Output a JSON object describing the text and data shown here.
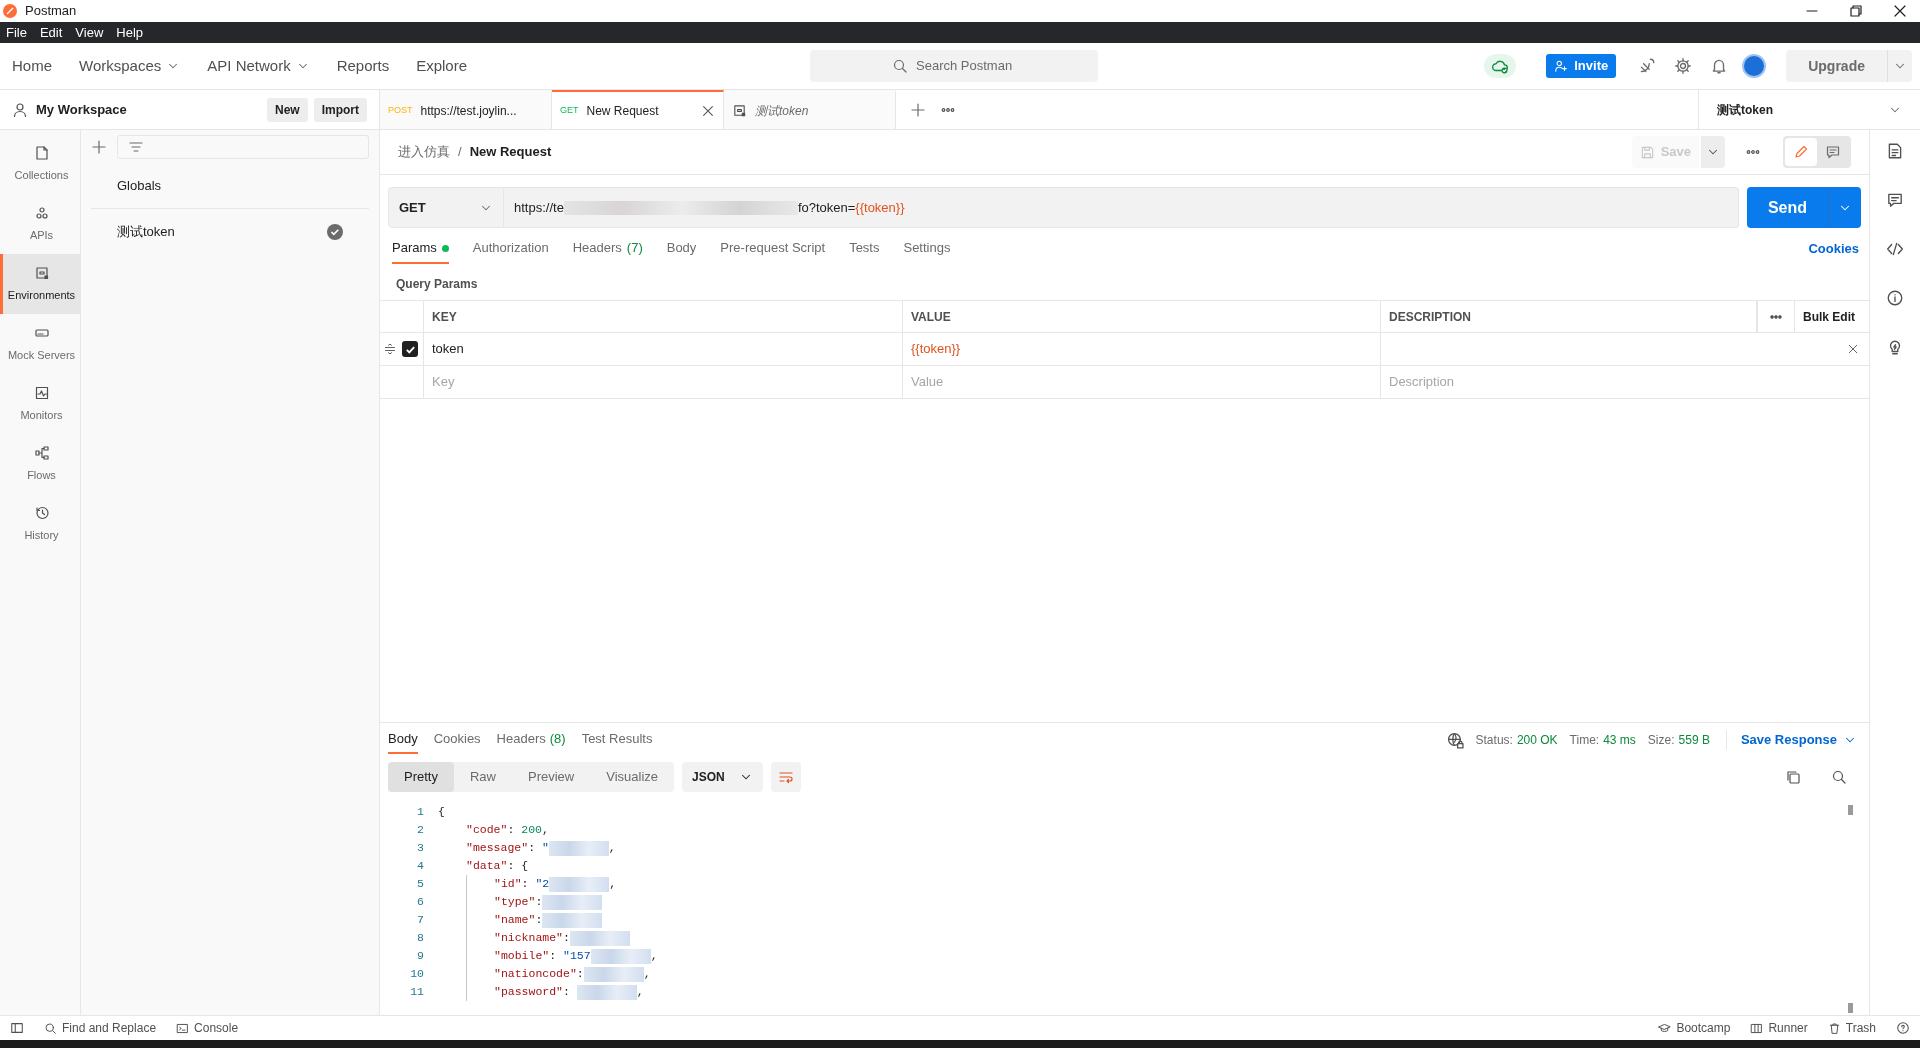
{
  "window": {
    "title": "Postman"
  },
  "menu": [
    "File",
    "Edit",
    "View",
    "Help"
  ],
  "header": {
    "nav": [
      {
        "label": "Home",
        "dropdown": false
      },
      {
        "label": "Workspaces",
        "dropdown": true
      },
      {
        "label": "API Network",
        "dropdown": true
      },
      {
        "label": "Reports",
        "dropdown": false
      },
      {
        "label": "Explore",
        "dropdown": false
      }
    ],
    "search": {
      "placeholder": "Search Postman"
    },
    "invite": "Invite",
    "upgrade": "Upgrade"
  },
  "workspace": {
    "name": "My Workspace",
    "buttons": [
      "New",
      "Import"
    ]
  },
  "rail": [
    {
      "label": "Collections",
      "selected": false
    },
    {
      "label": "APIs",
      "selected": false
    },
    {
      "label": "Environments",
      "selected": true
    },
    {
      "label": "Mock Servers",
      "selected": false
    },
    {
      "label": "Monitors",
      "selected": false
    },
    {
      "label": "Flows",
      "selected": false
    },
    {
      "label": "History",
      "selected": false
    }
  ],
  "environments": [
    {
      "label": "Globals",
      "active": false
    },
    {
      "label": "测试token",
      "active": true
    }
  ],
  "tabs": [
    {
      "kind": "request",
      "method": "POST",
      "label": "https://test.joylin...",
      "selected": false
    },
    {
      "kind": "request",
      "method": "GET",
      "label": "New Request",
      "selected": true
    },
    {
      "kind": "environment",
      "label": "测试token",
      "selected": false
    }
  ],
  "environment_selector": "测试token",
  "breadcrumb": [
    "进入仿真",
    "New Request"
  ],
  "breadcrumb_separator": "/",
  "save": {
    "label": "Save",
    "disabled": true
  },
  "request": {
    "method": "GET",
    "url": [
      {
        "kind": "text",
        "text": "https://te"
      },
      {
        "kind": "redacted"
      },
      {
        "kind": "text",
        "text": "fo?token="
      },
      {
        "kind": "variable",
        "text": "{{token}}"
      }
    ],
    "send": "Send"
  },
  "request_tabs": [
    {
      "label": "Params",
      "dot": true,
      "selected": true
    },
    {
      "label": "Authorization",
      "dot": false,
      "selected": false
    },
    {
      "label": "Headers",
      "count": "(7)",
      "dot": false,
      "selected": false
    },
    {
      "label": "Body",
      "dot": false,
      "selected": false
    },
    {
      "label": "Pre-request Script",
      "dot": false,
      "selected": false
    },
    {
      "label": "Tests",
      "dot": false,
      "selected": false
    },
    {
      "label": "Settings",
      "dot": false,
      "selected": false
    }
  ],
  "cookies_link": "Cookies",
  "query_params": {
    "title": "Query Params",
    "columns": [
      "KEY",
      "VALUE",
      "DESCRIPTION"
    ],
    "bulk_edit": "Bulk Edit",
    "rows": [
      {
        "key": "token",
        "value": "{{token}}",
        "checked": true
      }
    ],
    "new_row": [
      {
        "placeholder": "Key"
      },
      {
        "placeholder": "Value"
      },
      {
        "placeholder": "Description"
      }
    ]
  },
  "response": {
    "tabs": [
      {
        "label": "Body",
        "selected": true
      },
      {
        "label": "Cookies",
        "selected": false
      },
      {
        "label": "Headers",
        "count": "(8)",
        "selected": false
      },
      {
        "label": "Test Results",
        "selected": false
      }
    ],
    "stats": [
      {
        "label": "Status:",
        "value": "200 OK"
      },
      {
        "label": "Time:",
        "value": "43 ms"
      },
      {
        "label": "Size:",
        "value": "559 B"
      }
    ],
    "save_response": "Save Response",
    "views": [
      {
        "label": "Pretty",
        "selected": true
      },
      {
        "label": "Raw",
        "selected": false
      },
      {
        "label": "Preview",
        "selected": false
      },
      {
        "label": "Visualize",
        "selected": false
      }
    ],
    "format": "JSON",
    "code": [
      {
        "number": "1",
        "segments": [
          {
            "kind": "punct",
            "text": "{"
          }
        ],
        "children": [
          {
            "number": "2",
            "segments": [
              {
                "kind": "key",
                "text": "\"code\""
              },
              {
                "kind": "punct",
                "text": ": "
              },
              {
                "kind": "number",
                "text": "200"
              },
              {
                "kind": "punct",
                "text": ","
              }
            ]
          },
          {
            "number": "3",
            "segments": [
              {
                "kind": "key",
                "text": "\"message\""
              },
              {
                "kind": "punct",
                "text": ": "
              },
              {
                "kind": "string",
                "text": "\""
              },
              {
                "kind": "redacted"
              },
              {
                "kind": "punct",
                "text": ","
              }
            ]
          },
          {
            "number": "4",
            "segments": [
              {
                "kind": "key",
                "text": "\"data\""
              },
              {
                "kind": "punct",
                "text": ": {"
              }
            ],
            "children": [
              {
                "number": "5",
                "segments": [
                  {
                    "kind": "key",
                    "text": "\"id\""
                  },
                  {
                    "kind": "punct",
                    "text": ": "
                  },
                  {
                    "kind": "string",
                    "text": "\"2"
                  },
                  {
                    "kind": "redacted"
                  },
                  {
                    "kind": "punct",
                    "text": ","
                  }
                ]
              },
              {
                "number": "6",
                "segments": [
                  {
                    "kind": "key",
                    "text": "\"type\""
                  },
                  {
                    "kind": "punct",
                    "text": ":"
                  },
                  {
                    "kind": "redacted"
                  }
                ]
              },
              {
                "number": "7",
                "segments": [
                  {
                    "kind": "key",
                    "text": "\"name\""
                  },
                  {
                    "kind": "punct",
                    "text": ":"
                  },
                  {
                    "kind": "redacted"
                  }
                ]
              },
              {
                "number": "8",
                "segments": [
                  {
                    "kind": "key",
                    "text": "\"nickname\""
                  },
                  {
                    "kind": "punct",
                    "text": ":"
                  },
                  {
                    "kind": "redacted"
                  }
                ]
              },
              {
                "number": "9",
                "segments": [
                  {
                    "kind": "key",
                    "text": "\"mobile\""
                  },
                  {
                    "kind": "punct",
                    "text": ": "
                  },
                  {
                    "kind": "string",
                    "text": "\"157"
                  },
                  {
                    "kind": "redacted"
                  },
                  {
                    "kind": "punct",
                    "text": ","
                  }
                ]
              },
              {
                "number": "10",
                "segments": [
                  {
                    "kind": "key",
                    "text": "\"nationcode\""
                  },
                  {
                    "kind": "punct",
                    "text": ":"
                  },
                  {
                    "kind": "redacted"
                  },
                  {
                    "kind": "punct",
                    "text": ","
                  }
                ]
              },
              {
                "number": "11",
                "segments": [
                  {
                    "kind": "key",
                    "text": "\"password\""
                  },
                  {
                    "kind": "punct",
                    "text": ": "
                  },
                  {
                    "kind": "redacted"
                  },
                  {
                    "kind": "punct",
                    "text": ","
                  }
                ]
              }
            ]
          }
        ]
      }
    ]
  },
  "status_bar": {
    "left": [
      "Find and Replace",
      "Console"
    ],
    "right": [
      "Bootcamp",
      "Runner",
      "Trash"
    ]
  }
}
